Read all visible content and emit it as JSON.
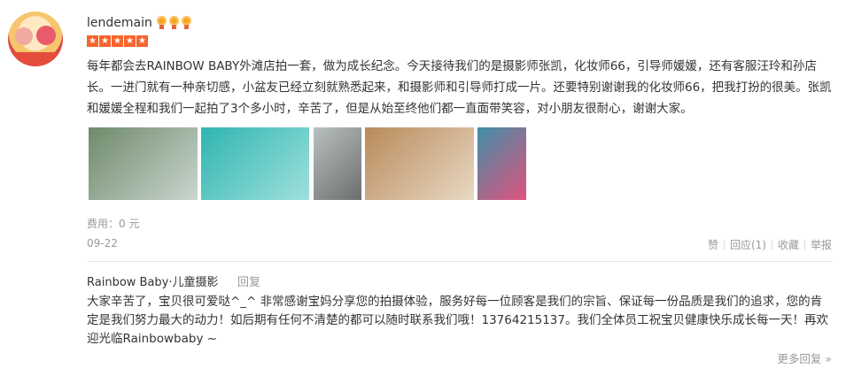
{
  "review": {
    "username": "lendemain",
    "medals": [
      "medal-icon",
      "medal-icon",
      "medal-icon"
    ],
    "rating": 5,
    "text": "每年都会去RAINBOW BABY外滩店拍一套，做为成长纪念。今天接待我们的是摄影师张凯，化妆师66，引导师媛媛，还有客服汪玲和孙店长。一进门就有一种亲切感，小盆友已经立刻就熟悉起来，和摄影师和引导师打成一片。还要特别谢谢我的化妆师66，把我打扮的很美。张凯和媛媛全程和我们一起拍了3个多小时，辛苦了，但是从始至终他们都一直面带笑容，对小朋友很耐心，谢谢大家。",
    "fee_label": "费用：",
    "fee_value": "0 元",
    "date": "09-22"
  },
  "photos": [
    {
      "name": "photo-1",
      "colors": [
        "#6f8a6a",
        "#c9d6cf"
      ]
    },
    {
      "name": "photo-2",
      "colors": [
        "#2fb5b0",
        "#9fe0dc"
      ]
    },
    {
      "name": "photo-3",
      "colors": [
        "#b9c0c0",
        "#6b6e6e"
      ]
    },
    {
      "name": "photo-4",
      "colors": [
        "#b98a5a",
        "#e8d9c4"
      ]
    },
    {
      "name": "photo-5",
      "colors": [
        "#3f8fa8",
        "#e2527d"
      ]
    }
  ],
  "actions": {
    "like": "赞",
    "reply": "回应(1)",
    "collect": "收藏",
    "report": "举报"
  },
  "reply": {
    "name": "Rainbow Baby·儿童摄影",
    "label": "回复",
    "text": "大家辛苦了，宝贝很可爱哒^_^ 非常感谢宝妈分享您的拍摄体验，服务好每一位顾客是我们的宗旨、保证每一份品质是我们的追求，您的肯定是我们努力最大的动力！如后期有任何不清楚的都可以随时联系我们哦！13764215137。我们全体员工祝宝贝健康快乐成长每一天！再欢迎光临Rainbowbaby ~"
  },
  "more_replies": "更多回复 »"
}
